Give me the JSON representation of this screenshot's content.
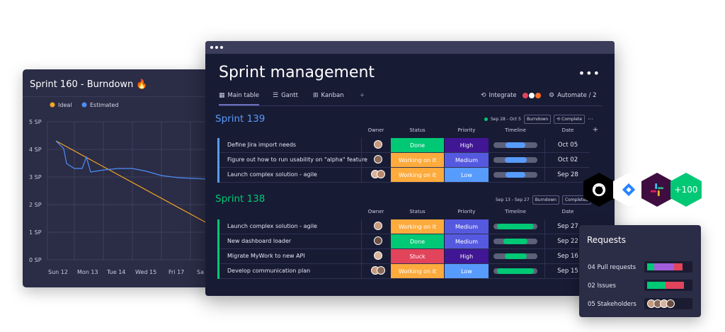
{
  "burndown": {
    "title": "Sprint 160 - Burndown 🔥",
    "legend": [
      {
        "label": "Ideal",
        "color": "#f5a623"
      },
      {
        "label": "Estimated",
        "color": "#4d8ef7"
      }
    ],
    "y_ticks": [
      "5 SP",
      "4 SP",
      "3 SP",
      "2 SP",
      "1 SP",
      "0 SP"
    ],
    "x_ticks": [
      "Sun 12",
      "Mon 13",
      "Tue 14",
      "Wed 15",
      "Fri 17",
      "Sa"
    ]
  },
  "main": {
    "title": "Sprint management",
    "more": "•••",
    "tabs": [
      {
        "label": "Main table",
        "icon": "table-icon"
      },
      {
        "label": "Gantt",
        "icon": "gantt-icon"
      },
      {
        "label": "Kanban",
        "icon": "kanban-icon"
      },
      {
        "label": "+",
        "icon": "add-icon"
      }
    ],
    "integrate_label": "Integrate",
    "automate_label": "Automate / 2",
    "columns": {
      "owner": "Owner",
      "status": "Status",
      "priority": "Priority",
      "timeline": "Timeline",
      "date": "Date",
      "add": "+"
    },
    "groups": [
      {
        "title": "Sprint 139",
        "color": "#579bfc",
        "dates": "Sep 28 - Oct 5",
        "burndown": "Burndown",
        "complete": "Complete",
        "more": "···",
        "rows": [
          {
            "name": "Define Jira import needs",
            "status": "Done",
            "status_color": "#00c875",
            "priority": "High",
            "priority_color": "#401694",
            "progress": 0.45,
            "date": "Oct 05"
          },
          {
            "name": "Figure out how to run usability on \"alpha\" feature",
            "status": "Working on it",
            "status_color": "#fdab3d",
            "priority": "Medium",
            "priority_color": "#5559df",
            "progress": 0.5,
            "date": "Oct 02"
          },
          {
            "name": "Launch complex solution - agile",
            "status": "Working on it",
            "status_color": "#fdab3d",
            "priority": "Low",
            "priority_color": "#579bfc",
            "progress": 0.45,
            "date": "Sep 28"
          }
        ]
      },
      {
        "title": "Sprint 138",
        "color": "#00c875",
        "dates": "Sep 13 - Sep 27",
        "burndown": "Burndown",
        "complete": "Completed",
        "rows": [
          {
            "name": "Launch complex solution - agile",
            "status": "Working on it",
            "status_color": "#fdab3d",
            "priority": "Medium",
            "priority_color": "#5559df",
            "progress": 0.85,
            "date": "Sep 27"
          },
          {
            "name": "New dashboard loader",
            "status": "Done",
            "status_color": "#00c875",
            "priority": "Medium",
            "priority_color": "#5559df",
            "progress": 0.55,
            "date": "Sep 22"
          },
          {
            "name": "Migrate MyWork to new API",
            "status": "Stuck",
            "status_color": "#e2445c",
            "priority": "High",
            "priority_color": "#401694",
            "progress": 0.5,
            "date": "Sep 16"
          },
          {
            "name": "Develop communication plan",
            "status": "Working on it",
            "status_color": "#fdab3d",
            "priority": "Low",
            "priority_color": "#579bfc",
            "progress": 0.85,
            "date": "Sep 15"
          }
        ]
      }
    ]
  },
  "integrations": [
    {
      "name": "github-icon",
      "bg": "#000000"
    },
    {
      "name": "jira-icon",
      "bg": "#ffffff"
    },
    {
      "name": "slack-icon",
      "bg": "#3f0e40"
    },
    {
      "name": "more-integrations",
      "label": "+100",
      "bg": "#00c875"
    }
  ],
  "requests": {
    "title": "Requests",
    "items": [
      {
        "label": "04  Pull requests"
      },
      {
        "label": "02  Issues"
      },
      {
        "label": "05  Stakeholders"
      }
    ]
  }
}
